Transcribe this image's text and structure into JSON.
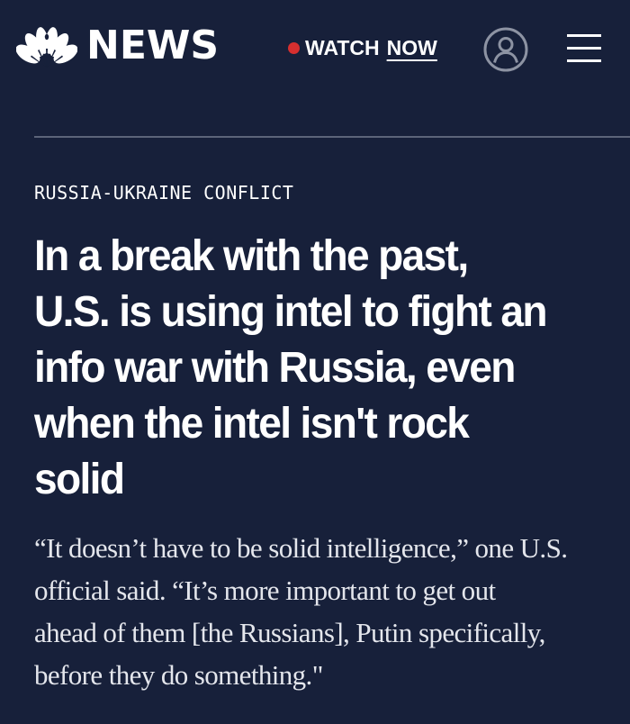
{
  "header": {
    "logo_text": "NEWS",
    "logo_icon": "nbc-peacock-icon",
    "watch_label": "WATCH",
    "watch_now_label": "NOW",
    "live_dot_color": "#d62f2f",
    "account_icon": "user-account-icon",
    "menu_icon": "hamburger-menu-icon"
  },
  "article": {
    "category": "RUSSIA-UKRAINE CONFLICT",
    "headline_lines": [
      "In a break with the past,",
      "U.S. is using intel to fight an",
      "info war with Russia, even",
      "when the intel isn't rock",
      "solid"
    ],
    "dek_lines": [
      "“It doesn’t have to be solid intelligence,” one U.S.",
      "official said. “It’s more important to get out",
      "ahead of them [the Russians], Putin specifically,",
      "before they do something.\""
    ]
  },
  "colors": {
    "background": "#17203a",
    "text": "#ffffff",
    "dek_text": "#e4e6ec",
    "divider": "#5c6479",
    "account_icon": "#8d93a3"
  }
}
